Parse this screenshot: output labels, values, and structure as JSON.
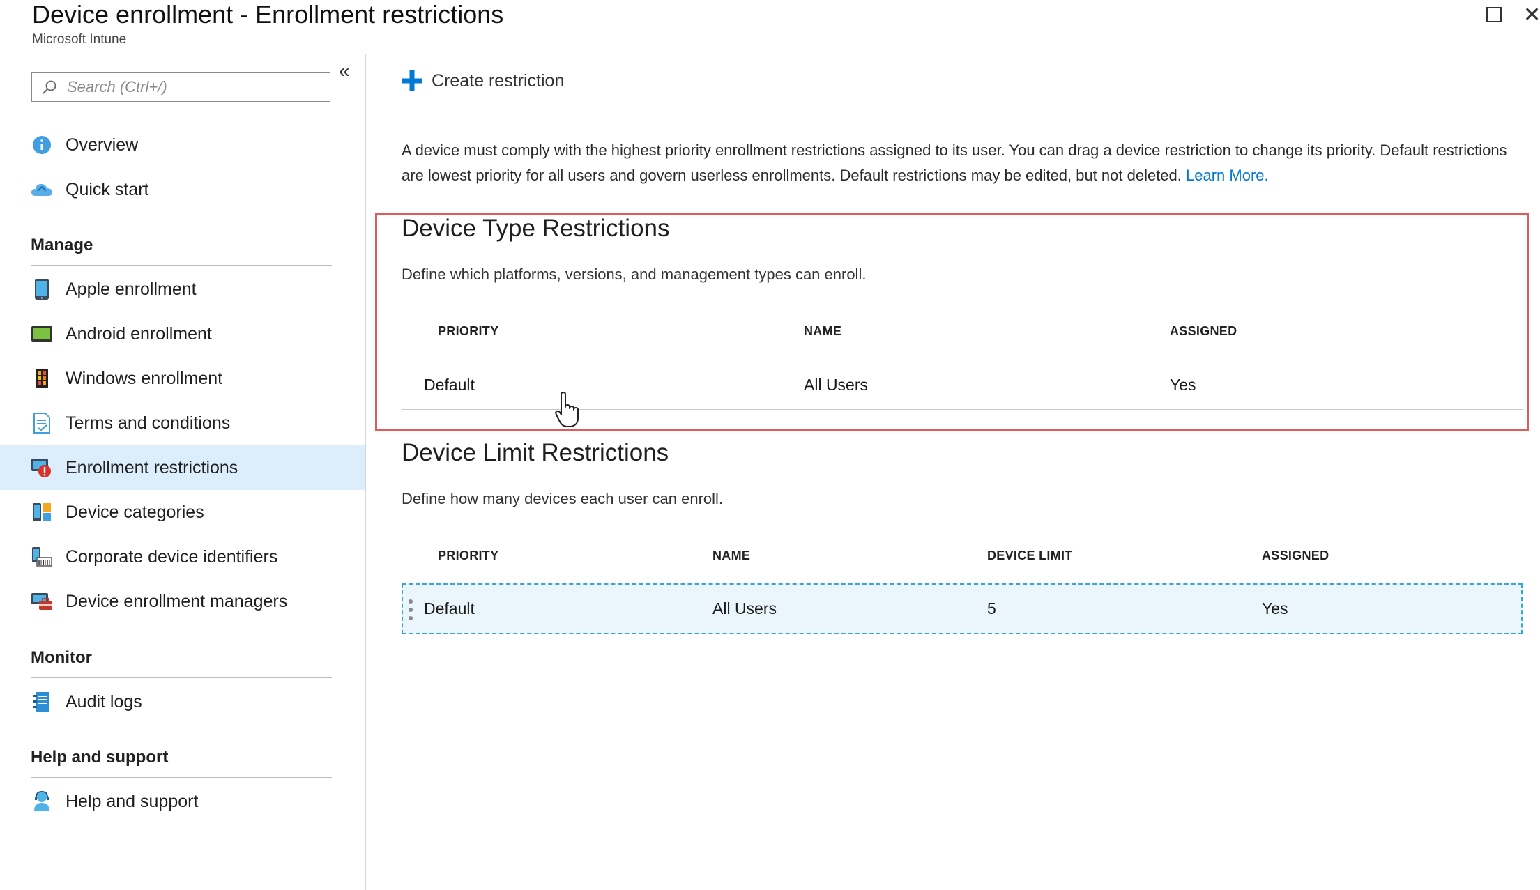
{
  "header": {
    "title": "Device enrollment - Enrollment restrictions",
    "subtitle": "Microsoft Intune"
  },
  "sidebar": {
    "search_placeholder": "Search (Ctrl+/)",
    "top_items": [
      {
        "label": "Overview",
        "icon": "info-icon"
      },
      {
        "label": "Quick start",
        "icon": "cloud-icon"
      }
    ],
    "sections": [
      {
        "title": "Manage",
        "items": [
          {
            "label": "Apple enrollment",
            "icon": "apple-device-icon"
          },
          {
            "label": "Android enrollment",
            "icon": "android-device-icon"
          },
          {
            "label": "Windows enrollment",
            "icon": "windows-device-icon"
          },
          {
            "label": "Terms and conditions",
            "icon": "document-check-icon"
          },
          {
            "label": "Enrollment restrictions",
            "icon": "restriction-icon",
            "active": true
          },
          {
            "label": "Device categories",
            "icon": "categories-icon"
          },
          {
            "label": "Corporate device identifiers",
            "icon": "identifiers-icon"
          },
          {
            "label": "Device enrollment managers",
            "icon": "managers-icon"
          }
        ]
      },
      {
        "title": "Monitor",
        "items": [
          {
            "label": "Audit logs",
            "icon": "log-book-icon"
          }
        ]
      },
      {
        "title": "Help and support",
        "items": [
          {
            "label": "Help and support",
            "icon": "support-person-icon"
          }
        ]
      }
    ]
  },
  "toolbar": {
    "create_label": "Create restriction"
  },
  "main": {
    "description": "A device must comply with the highest priority enrollment restrictions assigned to its user. You can drag a device restriction to change its priority. Default restrictions are lowest priority for all users and govern userless enrollments. Default restrictions may be edited, but not deleted.",
    "learn_more": "Learn More.",
    "device_type": {
      "title": "Device Type Restrictions",
      "description": "Define which platforms, versions, and management types can enroll.",
      "columns": [
        "PRIORITY",
        "NAME",
        "ASSIGNED"
      ],
      "rows": [
        {
          "priority": "Default",
          "name": "All Users",
          "assigned": "Yes"
        }
      ]
    },
    "device_limit": {
      "title": "Device Limit Restrictions",
      "description": "Define how many devices each user can enroll.",
      "columns": [
        "PRIORITY",
        "NAME",
        "DEVICE LIMIT",
        "ASSIGNED"
      ],
      "rows": [
        {
          "priority": "Default",
          "name": "All Users",
          "device_limit": "5",
          "assigned": "Yes"
        }
      ]
    }
  },
  "colors": {
    "accent": "#0078d4",
    "active_nav": "#dceefb",
    "highlight_border": "#e05a5a",
    "selected_row": "#ebf5fc",
    "selected_row_border": "#3aa3d8"
  }
}
